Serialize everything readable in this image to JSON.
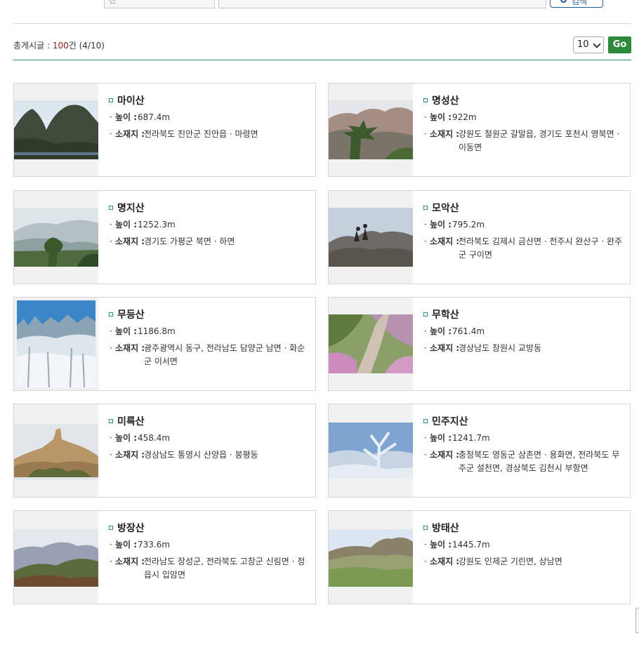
{
  "search": {
    "select_fragment": "전",
    "button_label": "검색"
  },
  "listing": {
    "count_label": "총게시글 : ",
    "count_value": "100",
    "count_suffix": "건 (4/10)"
  },
  "pager": {
    "per_page": "10",
    "go_label": "Go"
  },
  "labels": {
    "height": "높이 : ",
    "location": "소재지 : ",
    "bullet": "·"
  },
  "mountains": [
    {
      "name": "마이산",
      "height": "687.4m",
      "location": "전라북도 진안군 진안읍 · 마령면",
      "icon": "photo-twin-peaks"
    },
    {
      "name": "명성산",
      "height": "922m",
      "location": "강원도 철원군 갈말읍, 경기도 포천시 영북면 · 이동면",
      "icon": "photo-rocky-pine"
    },
    {
      "name": "명지산",
      "height": "1252.3m",
      "location": "경기도 가평군 북면 · 하면",
      "icon": "photo-misty-valley"
    },
    {
      "name": "모악산",
      "height": "795.2m",
      "location": "전라북도 김제시 금산면 · 전주시 완산구 · 완주군 구이면",
      "icon": "photo-rock-summit"
    },
    {
      "name": "무등산",
      "height": "1186.8m",
      "location": "광주광역시 동구, 전라남도 담양군 남면 · 화순군 이서면",
      "icon": "photo-frost-trees"
    },
    {
      "name": "무학산",
      "height": "761.4m",
      "location": "경상남도 창원시 교방동",
      "icon": "photo-azalea-trail"
    },
    {
      "name": "미륵산",
      "height": "458.4m",
      "location": "경상남도 통영시 산양읍 · 봉평동",
      "icon": "photo-rock-peak"
    },
    {
      "name": "민주지산",
      "height": "1241.7m",
      "location": "충청북도 영동군 상촌면 · 용화면, 전라북도 무주군 설천면, 경상북도 김천시 부항면",
      "icon": "photo-frost-branches"
    },
    {
      "name": "방장산",
      "height": "733.6m",
      "location": "전라남도 장성군, 전라북도 고창군 신림면 · 정읍시 입암면",
      "icon": "photo-ridge-silhouette"
    },
    {
      "name": "방태산",
      "height": "1445.7m",
      "location": "강원도 인제군 기린면, 상남면",
      "icon": "photo-grassland-ridge"
    }
  ]
}
